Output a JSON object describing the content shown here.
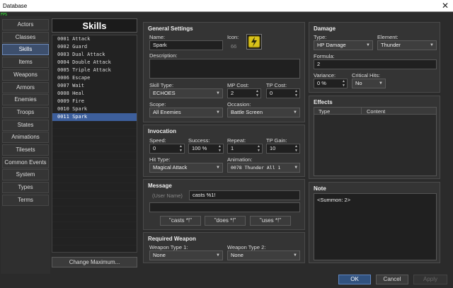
{
  "window": {
    "title": "Database",
    "fps": "FPS"
  },
  "categories": [
    "Actors",
    "Classes",
    "Skills",
    "Items",
    "Weapons",
    "Armors",
    "Enemies",
    "Troops",
    "States",
    "Animations",
    "Tilesets",
    "Common Events",
    "System",
    "Types",
    "Terms"
  ],
  "active_category": "Skills",
  "skills_panel": {
    "title": "Skills",
    "items": [
      "0001 Attack",
      "0002 Guard",
      "0003 Dual Attack",
      "0004 Double Attack",
      "0005 Triple Attack",
      "0006 Escape",
      "0007 Wait",
      "0008 Heal",
      "0009 Fire",
      "0010 Spark",
      "0011 Spark"
    ],
    "selected": "0011 Spark",
    "change_max_label": "Change Maximum..."
  },
  "general": {
    "title": "General Settings",
    "name_label": "Name:",
    "name_value": "Spark",
    "icon_label": "Icon:",
    "icon_index": "66",
    "description_label": "Description:",
    "skill_type_label": "Skill Type:",
    "skill_type_value": "ECHOES",
    "mp_cost_label": "MP Cost:",
    "mp_cost_value": "2",
    "tp_cost_label": "TP Cost:",
    "tp_cost_value": "0",
    "scope_label": "Scope:",
    "scope_value": "All Enemies",
    "occasion_label": "Occasion:",
    "occasion_value": "Battle Screen"
  },
  "invocation": {
    "title": "Invocation",
    "speed_label": "Speed:",
    "speed_value": "0",
    "success_label": "Success:",
    "success_value": "100 %",
    "repeat_label": "Repeat:",
    "repeat_value": "1",
    "tp_gain_label": "TP Gain:",
    "tp_gain_value": "10",
    "hit_type_label": "Hit Type:",
    "hit_type_value": "Magical Attack",
    "animation_label": "Animation:",
    "animation_value": "0078 Thunder All 1"
  },
  "message": {
    "title": "Message",
    "user_name_placeholder": "(User Name)",
    "line1": "casts %1!",
    "btn_casts": "\"casts *!\"",
    "btn_does": "\"does *!\"",
    "btn_uses": "\"uses *!\""
  },
  "required_weapon": {
    "title": "Required Weapon",
    "type1_label": "Weapon Type 1:",
    "type1_value": "None",
    "type2_label": "Weapon Type 2:",
    "type2_value": "None"
  },
  "damage": {
    "title": "Damage",
    "type_label": "Type:",
    "type_value": "HP Damage",
    "element_label": "Element:",
    "element_value": "Thunder",
    "formula_label": "Formula:",
    "formula_value": "2",
    "variance_label": "Variance:",
    "variance_value": "0 %",
    "critical_label": "Critical Hits:",
    "critical_value": "No"
  },
  "effects": {
    "title": "Effects",
    "col_type": "Type",
    "col_content": "Content"
  },
  "note": {
    "title": "Note",
    "value": "<Summon: 2>"
  },
  "dialog": {
    "ok": "OK",
    "cancel": "Cancel",
    "apply": "Apply"
  },
  "colors": {
    "accent": "#3d5f9c",
    "icon_yellow": "#e8d020"
  }
}
